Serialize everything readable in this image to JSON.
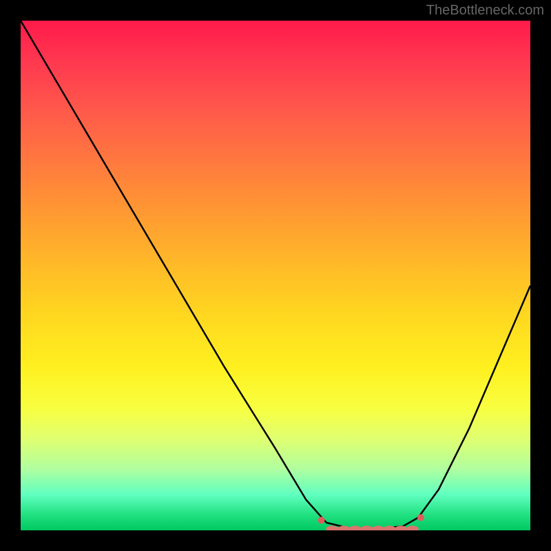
{
  "attribution": "TheBottleneck.com",
  "chart_data": {
    "type": "line",
    "title": "",
    "xlabel": "",
    "ylabel": "",
    "x_range": [
      0,
      100
    ],
    "y_range": [
      0,
      100
    ],
    "curve_points": [
      {
        "x": 0,
        "y": 100
      },
      {
        "x": 10,
        "y": 83
      },
      {
        "x": 20,
        "y": 66
      },
      {
        "x": 30,
        "y": 49
      },
      {
        "x": 40,
        "y": 32
      },
      {
        "x": 50,
        "y": 16
      },
      {
        "x": 56,
        "y": 6
      },
      {
        "x": 60,
        "y": 1.5
      },
      {
        "x": 65,
        "y": 0.3
      },
      {
        "x": 70,
        "y": 0.3
      },
      {
        "x": 75,
        "y": 0.8
      },
      {
        "x": 78,
        "y": 2.5
      },
      {
        "x": 82,
        "y": 8
      },
      {
        "x": 88,
        "y": 20
      },
      {
        "x": 94,
        "y": 34
      },
      {
        "x": 100,
        "y": 48
      }
    ],
    "optimal_zone": {
      "x_start": 60,
      "x_end": 78,
      "y": 0.5
    },
    "endpoint_markers": [
      {
        "x": 59,
        "y": 2
      },
      {
        "x": 78.5,
        "y": 2.5
      }
    ]
  }
}
